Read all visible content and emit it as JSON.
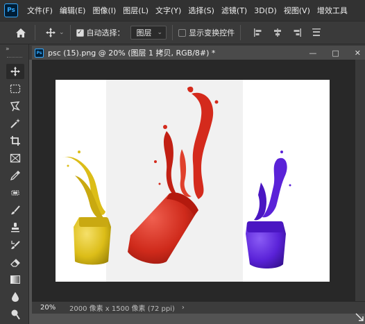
{
  "app": {
    "logo_text": "Ps",
    "menu": [
      "文件(F)",
      "编辑(E)",
      "图像(I)",
      "图层(L)",
      "文字(Y)",
      "选择(S)",
      "滤镜(T)",
      "3D(D)",
      "视图(V)",
      "增效工具"
    ]
  },
  "options": {
    "auto_select_checked": true,
    "auto_select_label": "自动选择：",
    "layer_select_value": "图层",
    "show_transform_checked": false,
    "show_transform_label": "显示变换控件"
  },
  "toolbar": {
    "collapse_glyph": "»",
    "tools": [
      "move-tool",
      "marquee-tool",
      "lasso-tool",
      "magic-wand-tool",
      "crop-tool",
      "frame-tool",
      "eyedropper-tool",
      "healing-tool",
      "brush-tool",
      "stamp-tool",
      "history-brush-tool",
      "eraser-tool",
      "gradient-tool",
      "blur-tool",
      "dodge-tool"
    ]
  },
  "document": {
    "tab_icon": "Ps",
    "tab_title": "psc (15).png @ 20% (图层 1 拷贝, RGB/8#) *",
    "win_minimize": "—",
    "win_maximize": "□",
    "win_close": "✕",
    "image_subject": "paint jars splashing: yellow, red, purple",
    "paint_colors": {
      "yellow": "#e0c21a",
      "red": "#d42a1c",
      "purple": "#5a22d8"
    }
  },
  "status": {
    "zoom": "20%",
    "doc_info": "2000 像素 x 1500 像素 (72 ppi)",
    "arrow": "›"
  }
}
